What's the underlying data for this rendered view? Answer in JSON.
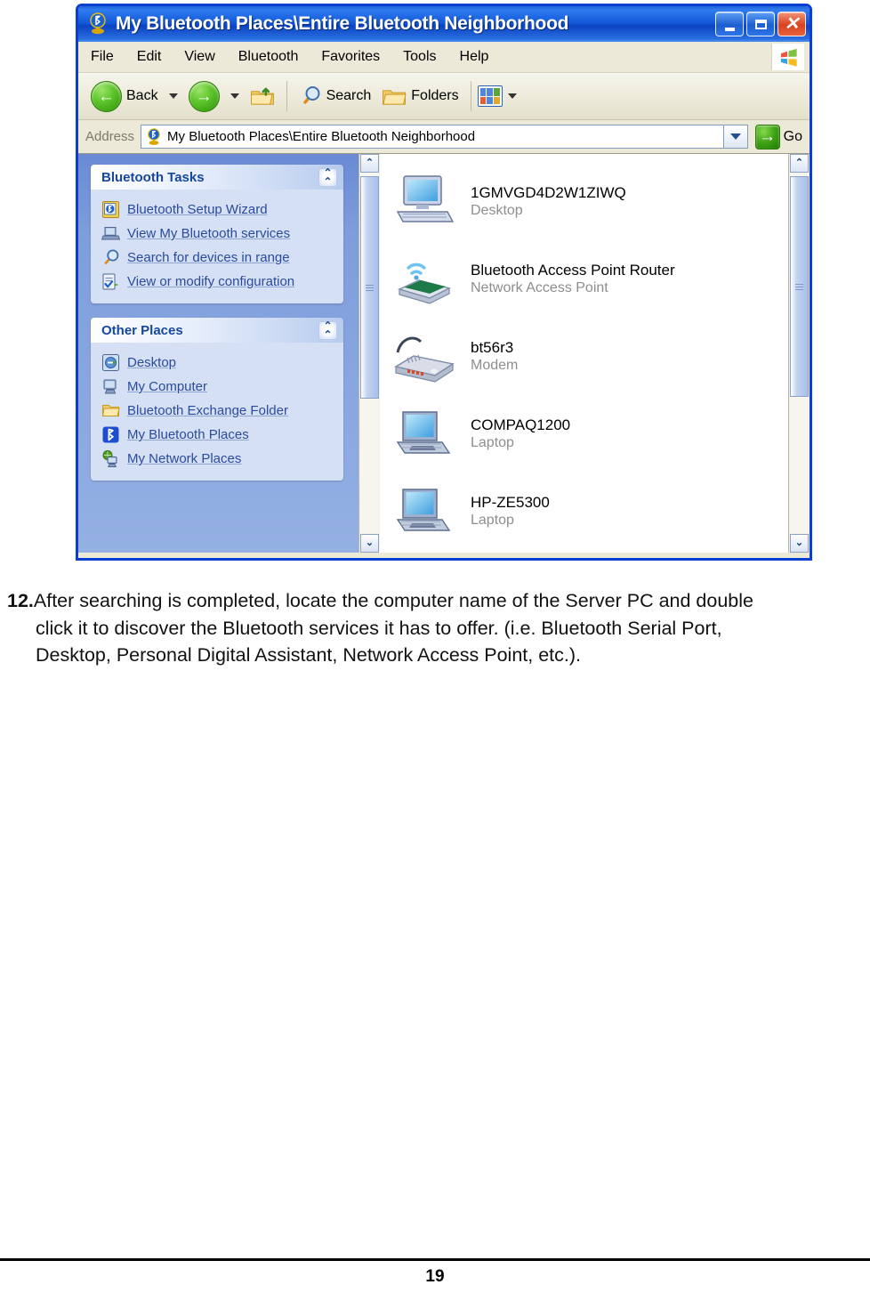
{
  "window": {
    "title": "My Bluetooth Places\\Entire Bluetooth Neighborhood",
    "title_icon": "bluetooth-globe-icon",
    "controls": {
      "minimize": "minimize-button",
      "maximize": "maximize-button",
      "close": "close-button"
    },
    "menu": [
      "File",
      "Edit",
      "View",
      "Bluetooth",
      "Favorites",
      "Tools",
      "Help"
    ],
    "windows_logo": "windows-flag-logo",
    "toolbar": {
      "back_label": "Back",
      "search_label": "Search",
      "folders_label": "Folders",
      "icons": [
        "back-arrow-icon",
        "forward-arrow-icon",
        "up-folder-icon",
        "search-magnifier-icon",
        "folders-icon",
        "views-icon"
      ]
    },
    "address": {
      "label": "Address",
      "icon": "bluetooth-globe-icon",
      "value": "My Bluetooth Places\\Entire Bluetooth Neighborhood",
      "go_label": "Go"
    }
  },
  "sidebar": {
    "panels": [
      {
        "title": "Bluetooth Tasks",
        "collapse_icon": "chevron-up-double-icon",
        "items": [
          {
            "label": "Bluetooth Setup Wizard",
            "icon": "bluetooth-wizard-icon"
          },
          {
            "label": "View My Bluetooth services",
            "icon": "laptop-icon"
          },
          {
            "label": "Search for devices in range",
            "icon": "magnifier-icon"
          },
          {
            "label": "View or modify configuration",
            "icon": "configuration-icon"
          }
        ]
      },
      {
        "title": "Other Places",
        "collapse_icon": "chevron-up-double-icon",
        "items": [
          {
            "label": "Desktop",
            "icon": "desktop-icon"
          },
          {
            "label": "My Computer",
            "icon": "my-computer-icon"
          },
          {
            "label": "Bluetooth Exchange Folder",
            "icon": "folder-icon"
          },
          {
            "label": "My Bluetooth Places",
            "icon": "bluetooth-icon"
          },
          {
            "label": "My Network Places",
            "icon": "network-places-icon"
          }
        ]
      }
    ]
  },
  "devices": [
    {
      "name": "1GMVGD4D2W1ZIWQ",
      "type": "Desktop",
      "icon": "desktop-computer-icon"
    },
    {
      "name": "Bluetooth Access Point Router",
      "type": "Network Access Point",
      "icon": "access-point-icon"
    },
    {
      "name": "bt56r3",
      "type": "Modem",
      "icon": "modem-icon"
    },
    {
      "name": "COMPAQ1200",
      "type": "Laptop",
      "icon": "laptop-computer-icon"
    },
    {
      "name": "HP-ZE5300",
      "type": "Laptop",
      "icon": "laptop-computer-icon"
    }
  ],
  "document": {
    "step_number": "12.",
    "step_line1": "After searching is completed, locate the computer name of the Server PC and double",
    "step_line2": "click it to discover the Bluetooth services it has to offer. (i.e. Bluetooth Serial Port,",
    "step_line3": "Desktop, Personal Digital Assistant, Network Access Point, etc.).",
    "page_number": "19"
  },
  "colors": {
    "titlebar_blue": "#0b43c2",
    "sidebar_blue": "#7e9ddc",
    "panel_body": "#d6e0f5",
    "link_blue": "#2a4b9b",
    "toolbar_beige": "#ece9d8"
  }
}
